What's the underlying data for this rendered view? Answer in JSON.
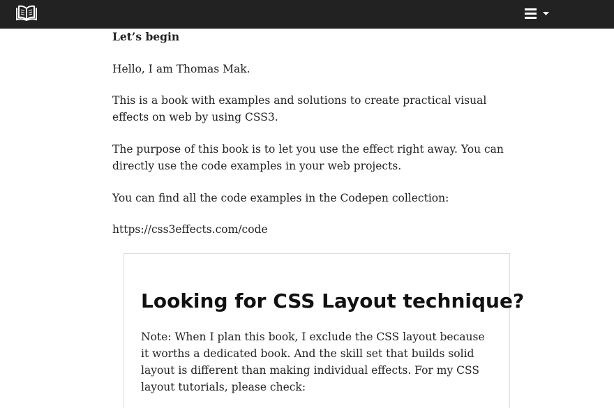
{
  "header": {
    "logo_icon": "open-book-icon",
    "menu_icon": "hamburger-icon",
    "dropdown_icon": "caret-down-icon",
    "background": "#222222"
  },
  "content": {
    "heading": "Let’s begin",
    "paragraphs": [
      "Hello, I am Thomas Mak.",
      "This is a book with examples and solutions to create practical visual effects on web by using CSS3.",
      "The purpose of this book is to let you use the effect right away. You can directly use the code examples in your web projects.",
      "You can find all the code examples in the Codepen collection:",
      "https://css3effects.com/code"
    ]
  },
  "callout": {
    "title": "Looking for CSS Layout technique?",
    "body": "Note: When I plan this book, I exclude the CSS layout because it worths a dedicated book. And the skill set that builds solid layout is different than making individual effects. For my CSS layout tutorials, please check:"
  }
}
